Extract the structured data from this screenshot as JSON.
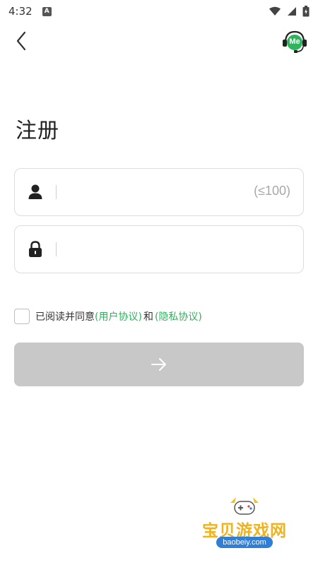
{
  "status_bar": {
    "time": "4:32",
    "notification_icon_letter": "A",
    "icons": [
      "wifi-icon",
      "cellular-icon",
      "battery-icon"
    ]
  },
  "header": {
    "back_icon": "chevron-left-icon",
    "support_badge": "Me",
    "support_icon": "headset-icon"
  },
  "page": {
    "title": "注册"
  },
  "form": {
    "username": {
      "icon": "user-icon",
      "placeholder": "(≤100)",
      "value": ""
    },
    "password": {
      "icon": "lock-icon",
      "placeholder": "",
      "value": ""
    }
  },
  "agreement": {
    "checked": false,
    "text": "已阅读并同意",
    "user_agreement": "(用户协议)",
    "and": "和",
    "privacy_policy": "(隐私协议)"
  },
  "submit": {
    "icon": "arrow-right-icon"
  },
  "watermark": {
    "text": "宝贝游戏网",
    "url": "baobeiy.com"
  },
  "colors": {
    "accent_green": "#2fb35d",
    "button_disabled": "#c8c8c8",
    "watermark_gold": "#f2b21b"
  }
}
